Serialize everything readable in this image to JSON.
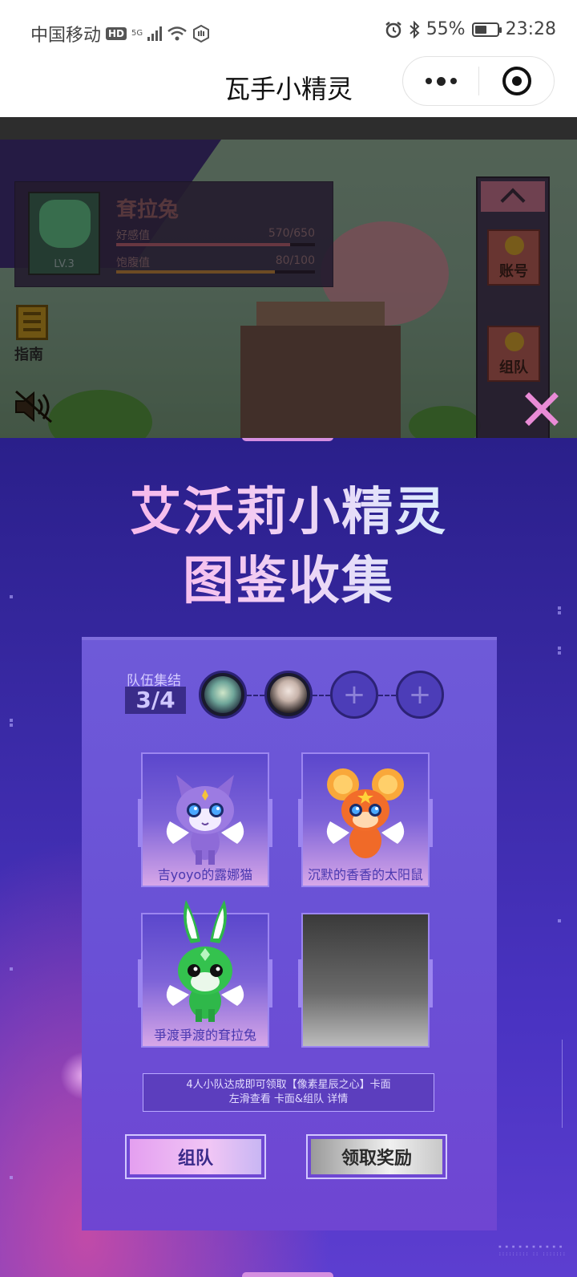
{
  "status_bar": {
    "carrier": "中国移动",
    "hd_badge": "HD",
    "network": "5G",
    "battery": "55%",
    "battery_level": 0.55,
    "time": "23:28"
  },
  "nav": {
    "title": "瓦手小精灵"
  },
  "game": {
    "pet_name": "耷拉兔",
    "level": "LV.3",
    "stats": [
      {
        "label": "好感值",
        "value": "570/650",
        "fraction": 0.877,
        "color": "#a85a6a"
      },
      {
        "label": "饱腹值",
        "value": "80/100",
        "fraction": 0.8,
        "color": "#b07a3a"
      }
    ],
    "guide_label": "指南",
    "side_buttons": [
      "账号",
      "组队"
    ]
  },
  "modal": {
    "title_line1": "艾沃莉小精灵",
    "title_line2": "图鉴收集",
    "team_label": "队伍集结",
    "team_count": "3/4",
    "slots": [
      "filled",
      "filled",
      "empty",
      "empty"
    ],
    "cards": [
      {
        "label": "吉yoyo的露娜猫",
        "creature": "purple-cat"
      },
      {
        "label": "沉默的香香的太阳鼠",
        "creature": "orange-mouse"
      },
      {
        "label": "爭渡爭渡的耷拉兔",
        "creature": "green-rabbit"
      },
      {
        "label": "",
        "creature": "locked"
      }
    ],
    "info_line1": "4人小队达成即可领取【像素星辰之心】卡面",
    "info_line2": "左滑查看 卡面&组队 详情",
    "team_button": "组队",
    "claim_button": "领取奖励"
  }
}
